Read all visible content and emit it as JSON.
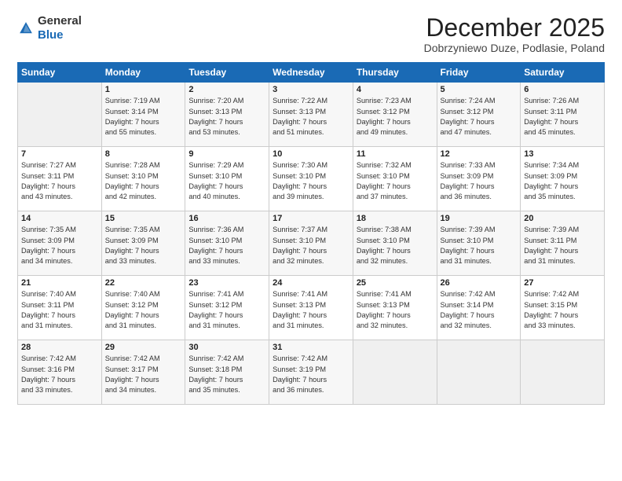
{
  "logo": {
    "general": "General",
    "blue": "Blue"
  },
  "title": "December 2025",
  "location": "Dobrzyniewo Duze, Podlasie, Poland",
  "header_days": [
    "Sunday",
    "Monday",
    "Tuesday",
    "Wednesday",
    "Thursday",
    "Friday",
    "Saturday"
  ],
  "weeks": [
    [
      {
        "day": "",
        "text": ""
      },
      {
        "day": "1",
        "text": "Sunrise: 7:19 AM\nSunset: 3:14 PM\nDaylight: 7 hours\nand 55 minutes."
      },
      {
        "day": "2",
        "text": "Sunrise: 7:20 AM\nSunset: 3:13 PM\nDaylight: 7 hours\nand 53 minutes."
      },
      {
        "day": "3",
        "text": "Sunrise: 7:22 AM\nSunset: 3:13 PM\nDaylight: 7 hours\nand 51 minutes."
      },
      {
        "day": "4",
        "text": "Sunrise: 7:23 AM\nSunset: 3:12 PM\nDaylight: 7 hours\nand 49 minutes."
      },
      {
        "day": "5",
        "text": "Sunrise: 7:24 AM\nSunset: 3:12 PM\nDaylight: 7 hours\nand 47 minutes."
      },
      {
        "day": "6",
        "text": "Sunrise: 7:26 AM\nSunset: 3:11 PM\nDaylight: 7 hours\nand 45 minutes."
      }
    ],
    [
      {
        "day": "7",
        "text": "Sunrise: 7:27 AM\nSunset: 3:11 PM\nDaylight: 7 hours\nand 43 minutes."
      },
      {
        "day": "8",
        "text": "Sunrise: 7:28 AM\nSunset: 3:10 PM\nDaylight: 7 hours\nand 42 minutes."
      },
      {
        "day": "9",
        "text": "Sunrise: 7:29 AM\nSunset: 3:10 PM\nDaylight: 7 hours\nand 40 minutes."
      },
      {
        "day": "10",
        "text": "Sunrise: 7:30 AM\nSunset: 3:10 PM\nDaylight: 7 hours\nand 39 minutes."
      },
      {
        "day": "11",
        "text": "Sunrise: 7:32 AM\nSunset: 3:10 PM\nDaylight: 7 hours\nand 37 minutes."
      },
      {
        "day": "12",
        "text": "Sunrise: 7:33 AM\nSunset: 3:09 PM\nDaylight: 7 hours\nand 36 minutes."
      },
      {
        "day": "13",
        "text": "Sunrise: 7:34 AM\nSunset: 3:09 PM\nDaylight: 7 hours\nand 35 minutes."
      }
    ],
    [
      {
        "day": "14",
        "text": "Sunrise: 7:35 AM\nSunset: 3:09 PM\nDaylight: 7 hours\nand 34 minutes."
      },
      {
        "day": "15",
        "text": "Sunrise: 7:35 AM\nSunset: 3:09 PM\nDaylight: 7 hours\nand 33 minutes."
      },
      {
        "day": "16",
        "text": "Sunrise: 7:36 AM\nSunset: 3:10 PM\nDaylight: 7 hours\nand 33 minutes."
      },
      {
        "day": "17",
        "text": "Sunrise: 7:37 AM\nSunset: 3:10 PM\nDaylight: 7 hours\nand 32 minutes."
      },
      {
        "day": "18",
        "text": "Sunrise: 7:38 AM\nSunset: 3:10 PM\nDaylight: 7 hours\nand 32 minutes."
      },
      {
        "day": "19",
        "text": "Sunrise: 7:39 AM\nSunset: 3:10 PM\nDaylight: 7 hours\nand 31 minutes."
      },
      {
        "day": "20",
        "text": "Sunrise: 7:39 AM\nSunset: 3:11 PM\nDaylight: 7 hours\nand 31 minutes."
      }
    ],
    [
      {
        "day": "21",
        "text": "Sunrise: 7:40 AM\nSunset: 3:11 PM\nDaylight: 7 hours\nand 31 minutes."
      },
      {
        "day": "22",
        "text": "Sunrise: 7:40 AM\nSunset: 3:12 PM\nDaylight: 7 hours\nand 31 minutes."
      },
      {
        "day": "23",
        "text": "Sunrise: 7:41 AM\nSunset: 3:12 PM\nDaylight: 7 hours\nand 31 minutes."
      },
      {
        "day": "24",
        "text": "Sunrise: 7:41 AM\nSunset: 3:13 PM\nDaylight: 7 hours\nand 31 minutes."
      },
      {
        "day": "25",
        "text": "Sunrise: 7:41 AM\nSunset: 3:13 PM\nDaylight: 7 hours\nand 32 minutes."
      },
      {
        "day": "26",
        "text": "Sunrise: 7:42 AM\nSunset: 3:14 PM\nDaylight: 7 hours\nand 32 minutes."
      },
      {
        "day": "27",
        "text": "Sunrise: 7:42 AM\nSunset: 3:15 PM\nDaylight: 7 hours\nand 33 minutes."
      }
    ],
    [
      {
        "day": "28",
        "text": "Sunrise: 7:42 AM\nSunset: 3:16 PM\nDaylight: 7 hours\nand 33 minutes."
      },
      {
        "day": "29",
        "text": "Sunrise: 7:42 AM\nSunset: 3:17 PM\nDaylight: 7 hours\nand 34 minutes."
      },
      {
        "day": "30",
        "text": "Sunrise: 7:42 AM\nSunset: 3:18 PM\nDaylight: 7 hours\nand 35 minutes."
      },
      {
        "day": "31",
        "text": "Sunrise: 7:42 AM\nSunset: 3:19 PM\nDaylight: 7 hours\nand 36 minutes."
      },
      {
        "day": "",
        "text": ""
      },
      {
        "day": "",
        "text": ""
      },
      {
        "day": "",
        "text": ""
      }
    ]
  ]
}
